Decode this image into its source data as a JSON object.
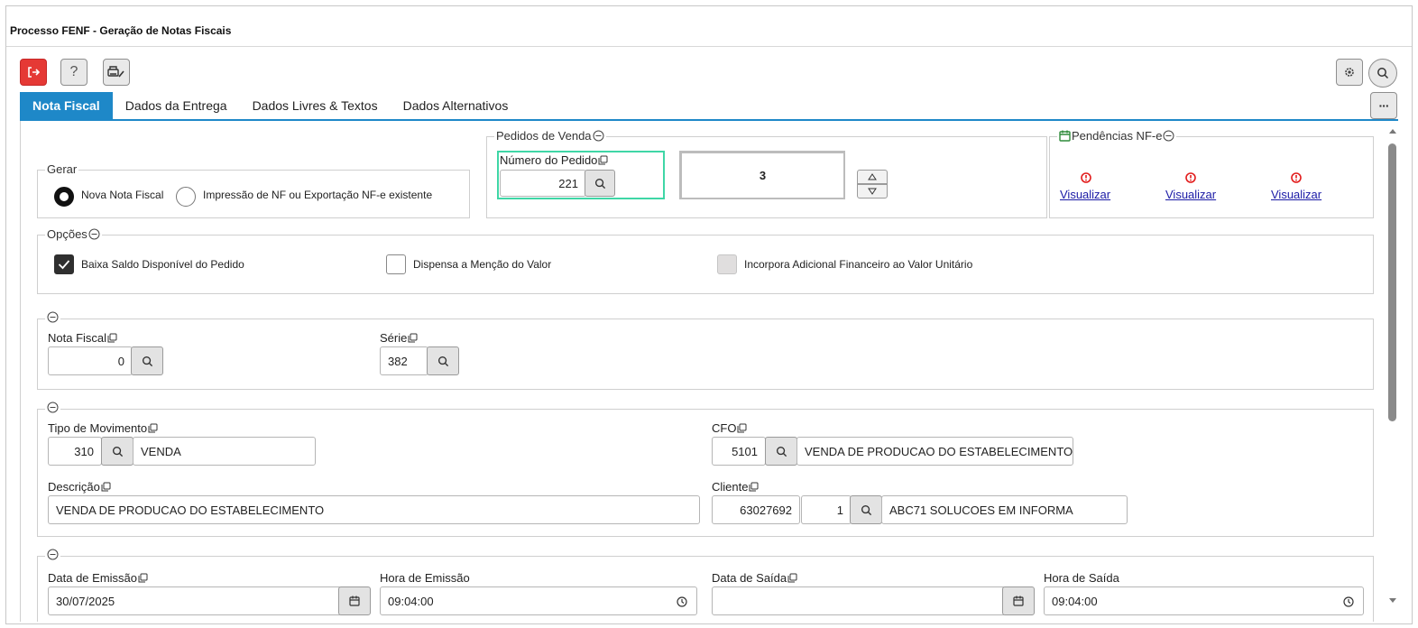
{
  "window": {
    "title": "Processo FENF - Geração de Notas Fiscais"
  },
  "toolbar": {
    "exit": "exit-icon",
    "help": "?",
    "print": "print-settings-icon",
    "settings": "gear-icon",
    "search": "search-icon",
    "more": "···"
  },
  "tabs": [
    "Nota Fiscal",
    "Dados da Entrega",
    "Dados Livres & Textos",
    "Dados Alternativos"
  ],
  "gerar": {
    "legend": "Gerar",
    "option1": "Nova Nota Fiscal",
    "option2": "Impressão de NF ou Exportação NF-e existente"
  },
  "pedidos": {
    "legend": "Pedidos de Venda",
    "numero_label": "Número do Pedido",
    "numero_value": "221",
    "count": "3"
  },
  "pendencias": {
    "legend": "Pendências NF-e",
    "link1": "Visualizar",
    "link2": "Visualizar",
    "link3": "Visualizar"
  },
  "opcoes": {
    "legend": "Opções",
    "opt1": "Baixa Saldo Disponível do Pedido",
    "opt2": "Dispensa a Menção do Valor",
    "opt3": "Incorpora Adicional Financeiro ao Valor Unitário"
  },
  "nf": {
    "nota_label": "Nota Fiscal",
    "nota_value": "0",
    "serie_label": "Série",
    "serie_value": "382"
  },
  "mov": {
    "tipo_label": "Tipo de Movimento",
    "tipo_code": "310",
    "tipo_desc": "VENDA",
    "cfo_label": "CFO",
    "cfo_code": "5101",
    "cfo_desc": "VENDA DE PRODUCAO DO ESTABELECIMENTO",
    "descricao_label": "Descrição",
    "descricao_value": "VENDA DE PRODUCAO DO ESTABELECIMENTO",
    "cliente_label": "Cliente",
    "cliente_code": "63027692",
    "cliente_seq": "1",
    "cliente_name": "ABC71 SOLUCOES EM INFORMA"
  },
  "datas": {
    "emissao_label": "Data de Emissão",
    "emissao_value": "30/07/2025",
    "hora_emissao_label": "Hora de Emissão",
    "hora_emissao_value": "09:04:00",
    "saida_label": "Data de Saída",
    "saida_value": "",
    "hora_saida_label": "Hora de Saída",
    "hora_saida_value": "09:04:00"
  }
}
